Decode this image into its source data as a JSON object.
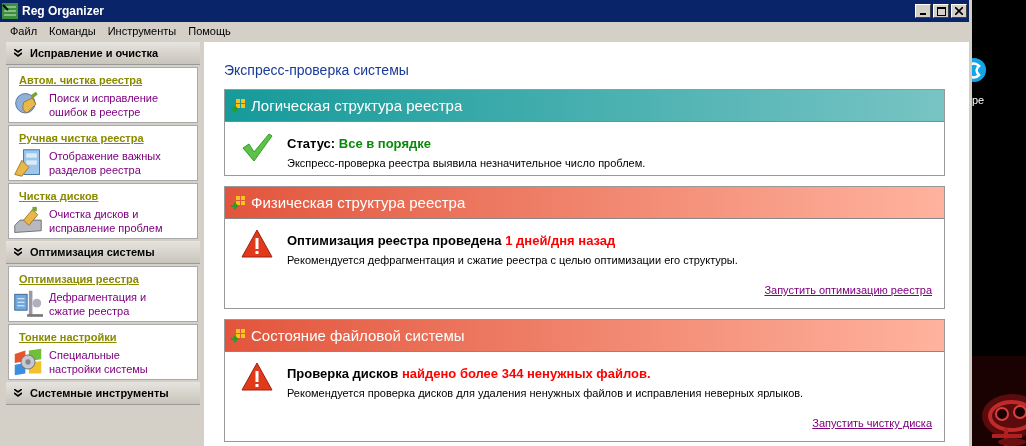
{
  "window": {
    "title": "Reg Organizer"
  },
  "menu": [
    "Файл",
    "Команды",
    "Инструменты",
    "Помощь"
  ],
  "sidebar": {
    "sections": [
      {
        "title": "Исправление и очистка",
        "expanded": true,
        "items": [
          {
            "title": "Автом. чистка реестра",
            "description": "Поиск и исправление ошибок в реестре"
          },
          {
            "title": "Ручная чистка реестра",
            "description": "Отображение важных разделов реестра"
          },
          {
            "title": "Чистка дисков",
            "description": "Очистка дисков и исправление проблем"
          }
        ]
      },
      {
        "title": "Оптимизация системы",
        "expanded": true,
        "items": [
          {
            "title": "Оптимизация реестра",
            "description": "Дефрагментация и сжатие реестра"
          },
          {
            "title": "Тонкие настройки",
            "description": "Специальные настройки системы"
          }
        ]
      },
      {
        "title": "Системные инструменты",
        "expanded": true
      }
    ]
  },
  "content": {
    "heading": "Экспресс-проверка системы",
    "panels": [
      {
        "kind": "ok",
        "title": "Логическая структура реестра",
        "status_label": "Статус:",
        "status_value": "Все в порядке",
        "description": "Экспресс-проверка реестра выявила незначительное число проблем."
      },
      {
        "kind": "warning",
        "title": "Физическая структура реестра",
        "status_label": "Оптимизация реестра проведена",
        "status_value": "1 дней/дня назад",
        "description": "Рекомендуется дефрагментация и сжатие реестра с целью оптимизации его структуры.",
        "link": "Запустить оптимизацию реестра"
      },
      {
        "kind": "warning",
        "title": "Состояние файловой системы",
        "status_label": "Проверка дисков",
        "status_value": "найдено более 344 ненужных файлов.",
        "description": "Рекомендуется проверка дисков для удаления ненужных файлов и исправления неверных ярлыков.",
        "link": "Запустить чистку диска"
      }
    ]
  },
  "desktop": {
    "icons": [
      {
        "label": "pe"
      }
    ]
  }
}
